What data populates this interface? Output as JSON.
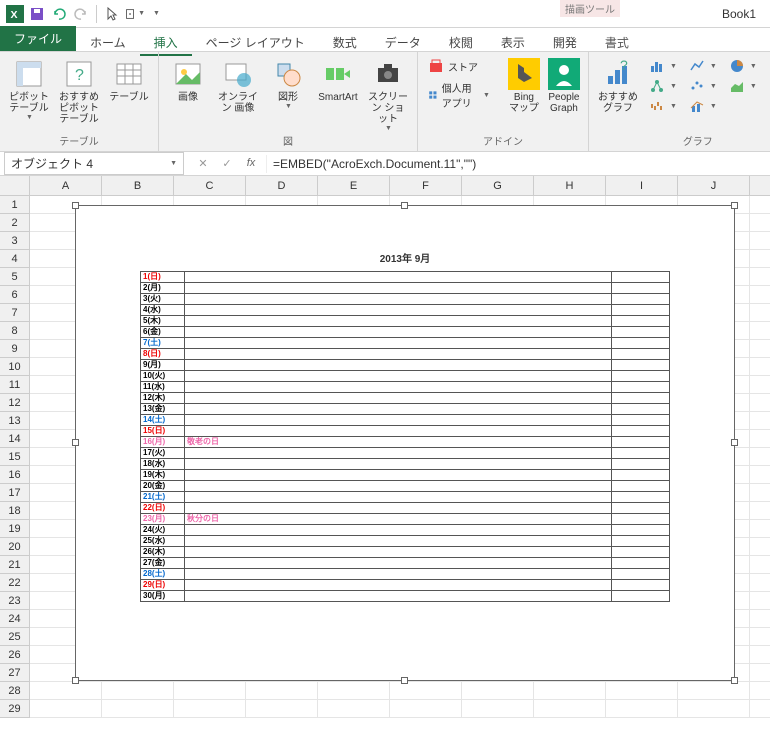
{
  "window": {
    "title": "Book1"
  },
  "context_tab_group": "描画ツール",
  "tabs": {
    "file": "ファイル",
    "items": [
      "ホーム",
      "挿入",
      "ページ レイアウト",
      "数式",
      "データ",
      "校閲",
      "表示",
      "開発",
      "書式"
    ],
    "active_index": 1
  },
  "ribbon": {
    "groups": {
      "tables": {
        "label": "テーブル",
        "pivot": "ピボット\nテーブル",
        "rec_pivot": "おすすめ\nピボットテーブル",
        "table": "テーブル"
      },
      "illustrations": {
        "label": "図",
        "picture": "画像",
        "online_pic": "オンライン\n画像",
        "shapes": "図形",
        "smartart": "SmartArt",
        "screenshot": "スクリーン\nショット"
      },
      "addins": {
        "label": "アドイン",
        "store": "ストア",
        "myapps": "個人用アプリ",
        "bing": "Bing\nマップ",
        "people": "People\nGraph"
      },
      "charts": {
        "label": "グラフ",
        "recommended": "おすすめ\nグラフ"
      }
    }
  },
  "formula_bar": {
    "namebox": "オブジェクト 4",
    "formula": "=EMBED(\"AcroExch.Document.11\",\"\")"
  },
  "sheet": {
    "columns": [
      "A",
      "B",
      "C",
      "D",
      "E",
      "F",
      "G",
      "H",
      "I",
      "J"
    ],
    "rows": [
      1,
      2,
      3,
      4,
      5,
      6,
      7,
      8,
      9,
      10,
      11,
      12,
      13,
      14,
      15,
      16,
      17,
      18,
      19,
      20,
      21,
      22,
      23,
      24,
      25,
      26,
      27,
      28,
      29
    ]
  },
  "embedded_calendar": {
    "title": "2013年 9月",
    "days": [
      {
        "label": "1(日)",
        "color": "c-red",
        "note": ""
      },
      {
        "label": "2(月)",
        "color": "c-black",
        "note": ""
      },
      {
        "label": "3(火)",
        "color": "c-black",
        "note": ""
      },
      {
        "label": "4(水)",
        "color": "c-black",
        "note": ""
      },
      {
        "label": "5(木)",
        "color": "c-black",
        "note": ""
      },
      {
        "label": "6(金)",
        "color": "c-black",
        "note": ""
      },
      {
        "label": "7(土)",
        "color": "c-blue",
        "note": ""
      },
      {
        "label": "8(日)",
        "color": "c-red",
        "note": ""
      },
      {
        "label": "9(月)",
        "color": "c-black",
        "note": ""
      },
      {
        "label": "10(火)",
        "color": "c-black",
        "note": ""
      },
      {
        "label": "11(水)",
        "color": "c-black",
        "note": ""
      },
      {
        "label": "12(木)",
        "color": "c-black",
        "note": ""
      },
      {
        "label": "13(金)",
        "color": "c-black",
        "note": ""
      },
      {
        "label": "14(土)",
        "color": "c-blue",
        "note": ""
      },
      {
        "label": "15(日)",
        "color": "c-red",
        "note": ""
      },
      {
        "label": "16(月)",
        "color": "c-pink",
        "note": "敬老の日",
        "note_color": "c-pink"
      },
      {
        "label": "17(火)",
        "color": "c-black",
        "note": ""
      },
      {
        "label": "18(水)",
        "color": "c-black",
        "note": ""
      },
      {
        "label": "19(木)",
        "color": "c-black",
        "note": ""
      },
      {
        "label": "20(金)",
        "color": "c-black",
        "note": ""
      },
      {
        "label": "21(土)",
        "color": "c-blue",
        "note": ""
      },
      {
        "label": "22(日)",
        "color": "c-red",
        "note": ""
      },
      {
        "label": "23(月)",
        "color": "c-pink",
        "note": "秋分の日",
        "note_color": "c-pink"
      },
      {
        "label": "24(火)",
        "color": "c-black",
        "note": ""
      },
      {
        "label": "25(水)",
        "color": "c-black",
        "note": ""
      },
      {
        "label": "26(木)",
        "color": "c-black",
        "note": ""
      },
      {
        "label": "27(金)",
        "color": "c-black",
        "note": ""
      },
      {
        "label": "28(土)",
        "color": "c-blue",
        "note": ""
      },
      {
        "label": "29(日)",
        "color": "c-red",
        "note": ""
      },
      {
        "label": "30(月)",
        "color": "c-black",
        "note": ""
      }
    ]
  }
}
